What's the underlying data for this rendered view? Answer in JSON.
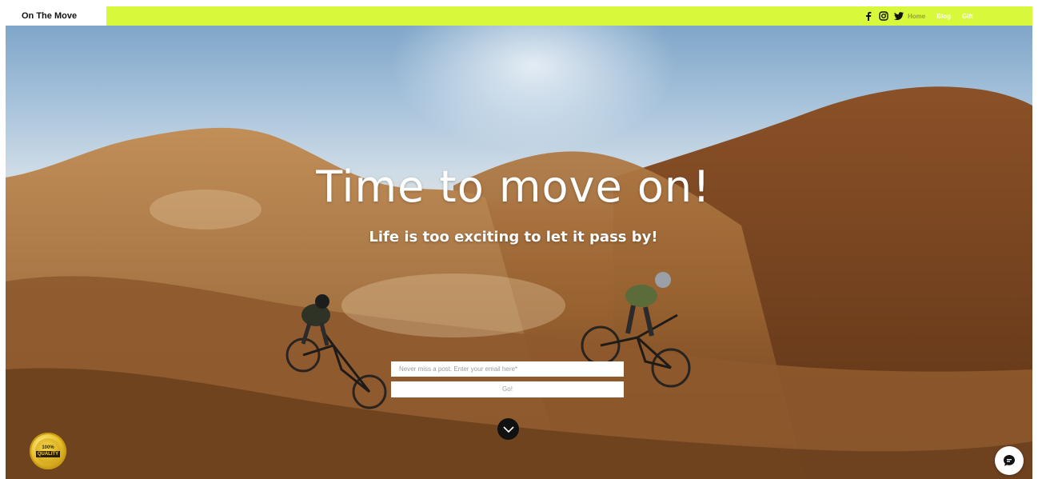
{
  "header": {
    "brand": "On The Move",
    "social": [
      {
        "icon": "facebook-icon",
        "glyph": "f"
      },
      {
        "icon": "instagram-icon",
        "glyph": ""
      },
      {
        "icon": "twitter-icon",
        "glyph": ""
      }
    ],
    "nav": [
      {
        "label": "Home",
        "active": true
      },
      {
        "label": "Blog",
        "active": false
      },
      {
        "label": "Gift",
        "active": false
      }
    ],
    "accent_color": "#d8f83c"
  },
  "hero": {
    "headline": "Time to move on!",
    "subheadline": "Life is too exciting to let it pass by!"
  },
  "subscribe": {
    "placeholder": "Never miss a post. Enter your email here*",
    "button_label": "Go!"
  },
  "badge": {
    "percent": "100%",
    "label": "QUALITY"
  },
  "chat": {
    "icon": "chat-icon"
  }
}
